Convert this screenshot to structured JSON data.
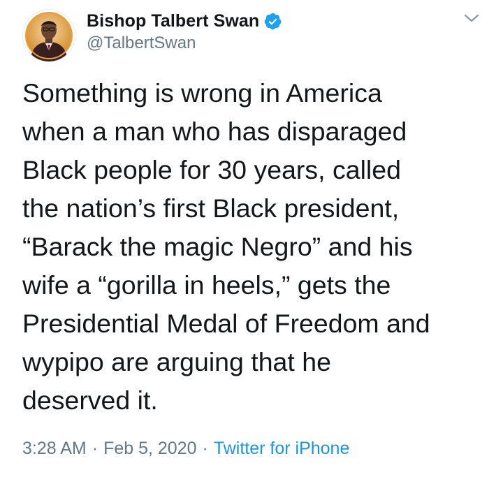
{
  "author": {
    "display_name": "Bishop Talbert Swan",
    "handle": "@TalbertSwan",
    "verified": true,
    "avatar_icon": "profile-photo"
  },
  "tweet": {
    "lines": [
      "Something is wrong in America",
      "when a man who has disparaged",
      "Black people for 30 years, called",
      "the nation’s first Black president,",
      "“Barack the magic Negro” and his",
      "wife a “gorilla in heels,” gets the",
      "Presidential Medal of Freedom and",
      "wypipo are arguing that he",
      "deserved it."
    ]
  },
  "meta": {
    "time": "3:28 AM",
    "separator": "·",
    "date": "Feb 5, 2020",
    "source": "Twitter for iPhone"
  },
  "colors": {
    "text": "#14171a",
    "secondary": "#657786",
    "link": "#1b95e0",
    "verified": "#1da1f2"
  },
  "icons": {
    "verified": "verified-badge-icon",
    "menu": "chevron-down-icon"
  }
}
